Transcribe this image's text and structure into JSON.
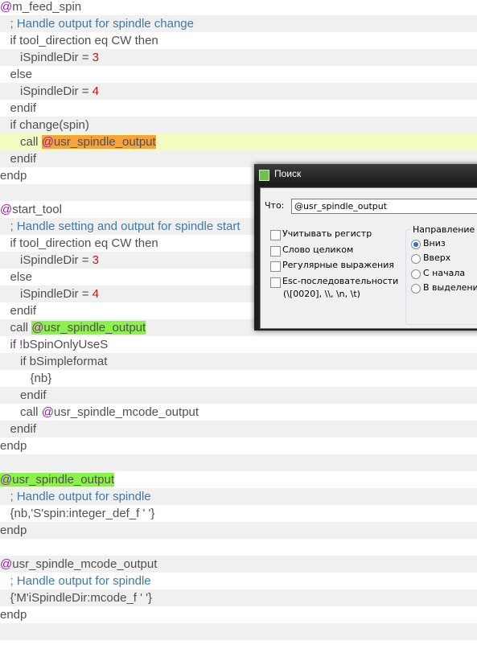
{
  "editor": {
    "lines": [
      [
        {
          "t": "@",
          "c": "at"
        },
        {
          "t": "m_feed_spin"
        }
      ],
      [
        {
          "t": "   ; Handle output for spindle change",
          "c": "cmt"
        }
      ],
      [
        {
          "t": "   if tool_direction eq CW then"
        }
      ],
      [
        {
          "t": "      iSpindleDir = "
        },
        {
          "t": "3",
          "c": "num"
        }
      ],
      [
        {
          "t": "   else"
        }
      ],
      [
        {
          "t": "      iSpindleDir = "
        },
        {
          "t": "4",
          "c": "num"
        }
      ],
      [
        {
          "t": "   endif"
        }
      ],
      [
        {
          "t": "   if change(spin)"
        }
      ],
      [
        {
          "t": "      call "
        },
        {
          "t": "@",
          "c": "at hl-o"
        },
        {
          "t": "usr_spindle_output",
          "c": "hl-o"
        }
      ],
      [
        {
          "t": "   endif"
        }
      ],
      [
        {
          "t": "endp"
        }
      ],
      [],
      [
        {
          "t": "@",
          "c": "at"
        },
        {
          "t": "start_tool"
        }
      ],
      [
        {
          "t": "   ; Handle setting and output for spindle start",
          "c": "cmt"
        }
      ],
      [
        {
          "t": "   if tool_direction eq CW then"
        }
      ],
      [
        {
          "t": "      iSpindleDir = "
        },
        {
          "t": "3",
          "c": "num"
        }
      ],
      [
        {
          "t": "   else"
        }
      ],
      [
        {
          "t": "      iSpindleDir = "
        },
        {
          "t": "4",
          "c": "num"
        }
      ],
      [
        {
          "t": "   endif"
        }
      ],
      [
        {
          "t": "   call "
        },
        {
          "t": "@",
          "c": "at hl-g"
        },
        {
          "t": "usr_spindle_output",
          "c": "hl-g"
        }
      ],
      [
        {
          "t": "   if "
        },
        {
          "t": "!",
          "c": "at"
        },
        {
          "t": "bSpinOnlyUseS"
        }
      ],
      [
        {
          "t": "      if bSimpleformat"
        }
      ],
      [
        {
          "t": "         {nb}"
        }
      ],
      [
        {
          "t": "      endif"
        }
      ],
      [
        {
          "t": "      call "
        },
        {
          "t": "@",
          "c": "at"
        },
        {
          "t": "usr_spindle_mcode_output"
        }
      ],
      [
        {
          "t": "   endif"
        }
      ],
      [
        {
          "t": "endp"
        }
      ],
      [],
      [
        {
          "t": "@",
          "c": "at hl-g"
        },
        {
          "t": "usr_spindle_output",
          "c": "hl-g"
        }
      ],
      [
        {
          "t": "   ; Handle output for spindle",
          "c": "cmt"
        }
      ],
      [
        {
          "t": "   {nb,'S'spin:integer_def_f ' '}"
        }
      ],
      [
        {
          "t": "endp"
        }
      ],
      [],
      [
        {
          "t": "@",
          "c": "at"
        },
        {
          "t": "usr_spindle_mcode_output"
        }
      ],
      [
        {
          "t": "   ; Handle output for spindle",
          "c": "cmt"
        }
      ],
      [
        {
          "t": "   {'M'iSpindleDir:mcode_f ' '}"
        }
      ],
      [
        {
          "t": "endp"
        }
      ],
      [],
      []
    ],
    "current_line": 8
  },
  "find_dialog": {
    "title": "Поиск",
    "find_label": "Что:",
    "find_value": "@usr_spindle_output",
    "match_case": "Учитывать регистр",
    "whole_word": "Слово целиком",
    "regex": "Регулярные выражения",
    "escape_line1": "Esc-последовательности",
    "escape_line2": "(\\[0020], \\\\, \\n, \\t)",
    "direction_title": "Направление",
    "dir_down": "Вниз",
    "dir_up": "Вверх",
    "dir_from_start": "С начала",
    "dir_in_selection": "В выделении",
    "selected_direction": "dir_down"
  }
}
